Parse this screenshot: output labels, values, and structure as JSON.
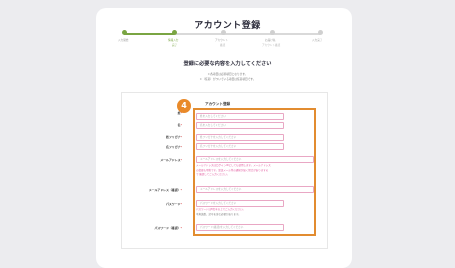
{
  "page_title": "アカウント登録",
  "steps": [
    {
      "label": "入力開始",
      "sub": "",
      "state": "done"
    },
    {
      "label": "情報入力",
      "sub": "完了",
      "state": "active"
    },
    {
      "label": "アカウント",
      "sub": "確認",
      "state": ""
    },
    {
      "label": "お届け先",
      "sub": "アカウント確認",
      "state": ""
    },
    {
      "label": "入力完了",
      "sub": "",
      "state": ""
    }
  ],
  "main_heading": "登録に必要な内容を入力してください",
  "notes": [
    "＊各項目は必須項目となります。",
    "＊（任意）がついている項目は任意項目です。"
  ],
  "form": {
    "section_title": "アカウント登録",
    "badge": "4",
    "last_name_label": "姓",
    "last_name_placeholder": "姓を入力してください",
    "first_name_label": "名",
    "first_name_placeholder": "名を入力してください",
    "last_kana_label": "姓フリガナ",
    "last_kana_placeholder": "姓フリガナを入力してください",
    "first_kana_label": "名フリガナ",
    "first_kana_placeholder": "名フリガナを入力してください",
    "email_label": "メールアドレス",
    "email_placeholder": "メールアドレスを入力してください",
    "email_hint": [
      "メールアドレスはログインIDとしても使用します。メールアドレス",
      "の変更も可能です。認証メール等の通知が届く場合がありますの",
      "で 確認してご入力ください。"
    ],
    "email_confirm_label": "メールアドレス（確認）",
    "email_confirm_placeholder": "メールアドレスを入力してください",
    "password_label": "パスワード",
    "password_placeholder": "パスワードを入力してください",
    "password_hint": [
      "パスワードは8文字以上でご入力ください。",
      "半角英数、記号を含む必要があります。"
    ],
    "password_confirm_label": "パスワード（確認）",
    "password_confirm_placeholder": "パスワード(確認)を入力してください",
    "required_mark": "*"
  },
  "colors": {
    "accent_green": "#7aa543",
    "highlight_orange": "#e28c30",
    "input_border_pink": "#e9a7c4"
  }
}
